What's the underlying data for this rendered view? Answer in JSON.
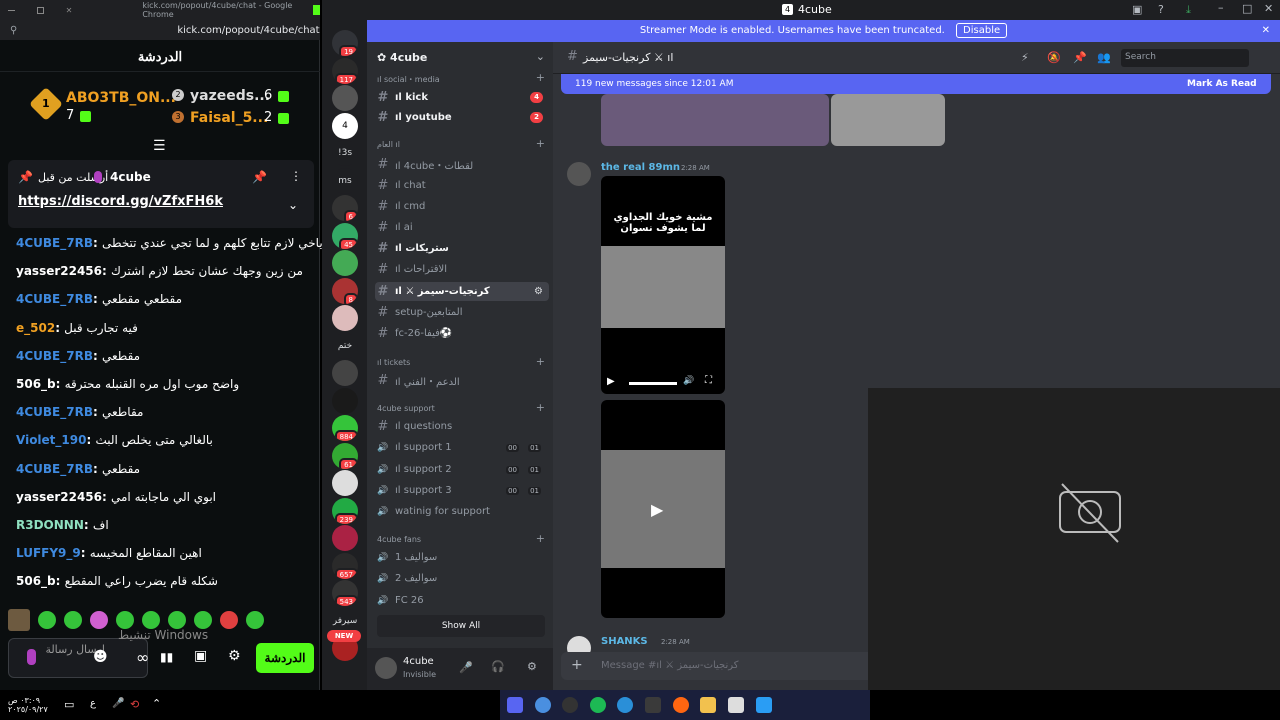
{
  "kick": {
    "chrome_title": "kick.com/popout/4cube/chat - Google Chrome",
    "url": "kick.com/popout/4cube/chat",
    "header": "الدردشة",
    "gifters": [
      {
        "rank": "1",
        "name": "ABO3TB_ON...",
        "count": "7"
      },
      {
        "rank": "2",
        "name": "yazeeds...",
        "count": "6"
      },
      {
        "rank": "3",
        "name": "Faisal_5...",
        "count": "2"
      }
    ],
    "pinned": {
      "by_label": "أرسلت من قبل",
      "channel": "4cube",
      "link": "https://discord.gg/vZfxFH6k"
    },
    "messages": [
      {
        "user": "4CUBE_7RB",
        "text": "ياخي لازم تتابع كلهم و لما تجي عندي تتخطى",
        "color": "#3f8ae0"
      },
      {
        "user": "yasser22456",
        "text": "من زين وجهك عشان تحط لازم اشترك",
        "color": "#ffffff"
      },
      {
        "user": "4CUBE_7RB",
        "text": "مقطعي مقطعي",
        "color": "#3f8ae0"
      },
      {
        "user": "e_502",
        "text": "فيه تجارب قبل",
        "color": "#f0a022"
      },
      {
        "user": "4CUBE_7RB",
        "text": "مقطعي",
        "color": "#3f8ae0"
      },
      {
        "user": "506_b",
        "text": "واضح موب اول مره القنبله محترقه",
        "color": "#ffffff"
      },
      {
        "user": "4CUBE_7RB",
        "text": "مقاطعي",
        "color": "#3f8ae0"
      },
      {
        "user": "Violet_190",
        "text": "بالغالي متى يخلص البث",
        "color": "#3f8ae0"
      },
      {
        "user": "4CUBE_7RB",
        "text": "مقطعي",
        "color": "#3f8ae0"
      },
      {
        "user": "yasser22456",
        "text": "ابوي الي ماجابته امي",
        "color": "#ffffff"
      },
      {
        "user": "R3DONNN",
        "text": "اف",
        "color": "#8fe0c0"
      },
      {
        "user": "LUFFY9_9",
        "text": "اهين المقاطع المخيسه",
        "color": "#3f8ae0"
      },
      {
        "user": "506_b",
        "text": "شكله قام يضرب راعي المقطع",
        "color": "#ffffff"
      }
    ],
    "input_placeholder": "إرسال رسالة",
    "chat_button": "الدردشة",
    "watermark": "تنشيط Windows"
  },
  "discord": {
    "window_title": "4cube",
    "banner": "Streamer Mode is enabled. Usernames have been truncated.",
    "banner_btn": "Disable",
    "server_name": "4cube",
    "categories": [
      {
        "label": "ıl social・media"
      },
      {
        "label": "العام ıl"
      },
      {
        "label": "ıl tickets"
      },
      {
        "label": "4cube support"
      },
      {
        "label": "4cube fans"
      }
    ],
    "channels": [
      {
        "name": "ıl kick",
        "badge": "4"
      },
      {
        "name": "ıl youtube",
        "badge": "2"
      },
      {
        "name": "ıl 4cube・لقطات"
      },
      {
        "name": "ıl chat"
      },
      {
        "name": "ıl cmd"
      },
      {
        "name": "ıl ai"
      },
      {
        "name": "ıl ستريكات"
      },
      {
        "name": "ıl الاقتراحات"
      },
      {
        "name": "ıl ⚔ كرنجيات-سيمز"
      },
      {
        "name": "setup-المتابعين"
      },
      {
        "name": "fc-26-فيفا⚽"
      },
      {
        "name": "ıl الدعم・الفني"
      },
      {
        "name": "ıl questions"
      },
      {
        "name": "ıl support 1",
        "t1": "00",
        "t2": "01"
      },
      {
        "name": "ıl support 2",
        "t1": "00",
        "t2": "01"
      },
      {
        "name": "ıl support 3",
        "t1": "00",
        "t2": "01"
      },
      {
        "name": "watinig for support"
      },
      {
        "name": "سواليف 1"
      },
      {
        "name": "سواليف 2"
      },
      {
        "name": "FC 26"
      }
    ],
    "show_all": "Show All",
    "user": {
      "name": "4cube",
      "status": "Invisible"
    },
    "channel_title": "كرنجيات-سيمز ⚔ ıl",
    "search_placeholder": "Search",
    "new_messages": "119 new messages since 12:01 AM",
    "mark_read": "Mark As Read",
    "msg1": {
      "author": "the real 89mn",
      "time": "2:28 AM",
      "video_caption": "مشية خويك الجداوي لما يشوف نسوان"
    },
    "msg2": {
      "author": "SHANKS",
      "time": "2:28 AM"
    },
    "composer_placeholder": "Message #ıl ⚔ كرنجيات-سيمز",
    "guild_labels": [
      "!3s",
      "ms",
      "ختم",
      "سيرفر"
    ],
    "guild_badges": [
      "19",
      "117",
      "6",
      "45",
      "8",
      "884",
      "61",
      "239",
      "657",
      "543"
    ],
    "new_label": "NEW"
  },
  "taskbar": {
    "time": "٠٣:٠٩ ص",
    "date": "٢٠٢٥/٠٩/٢٧",
    "lang": "ع"
  }
}
